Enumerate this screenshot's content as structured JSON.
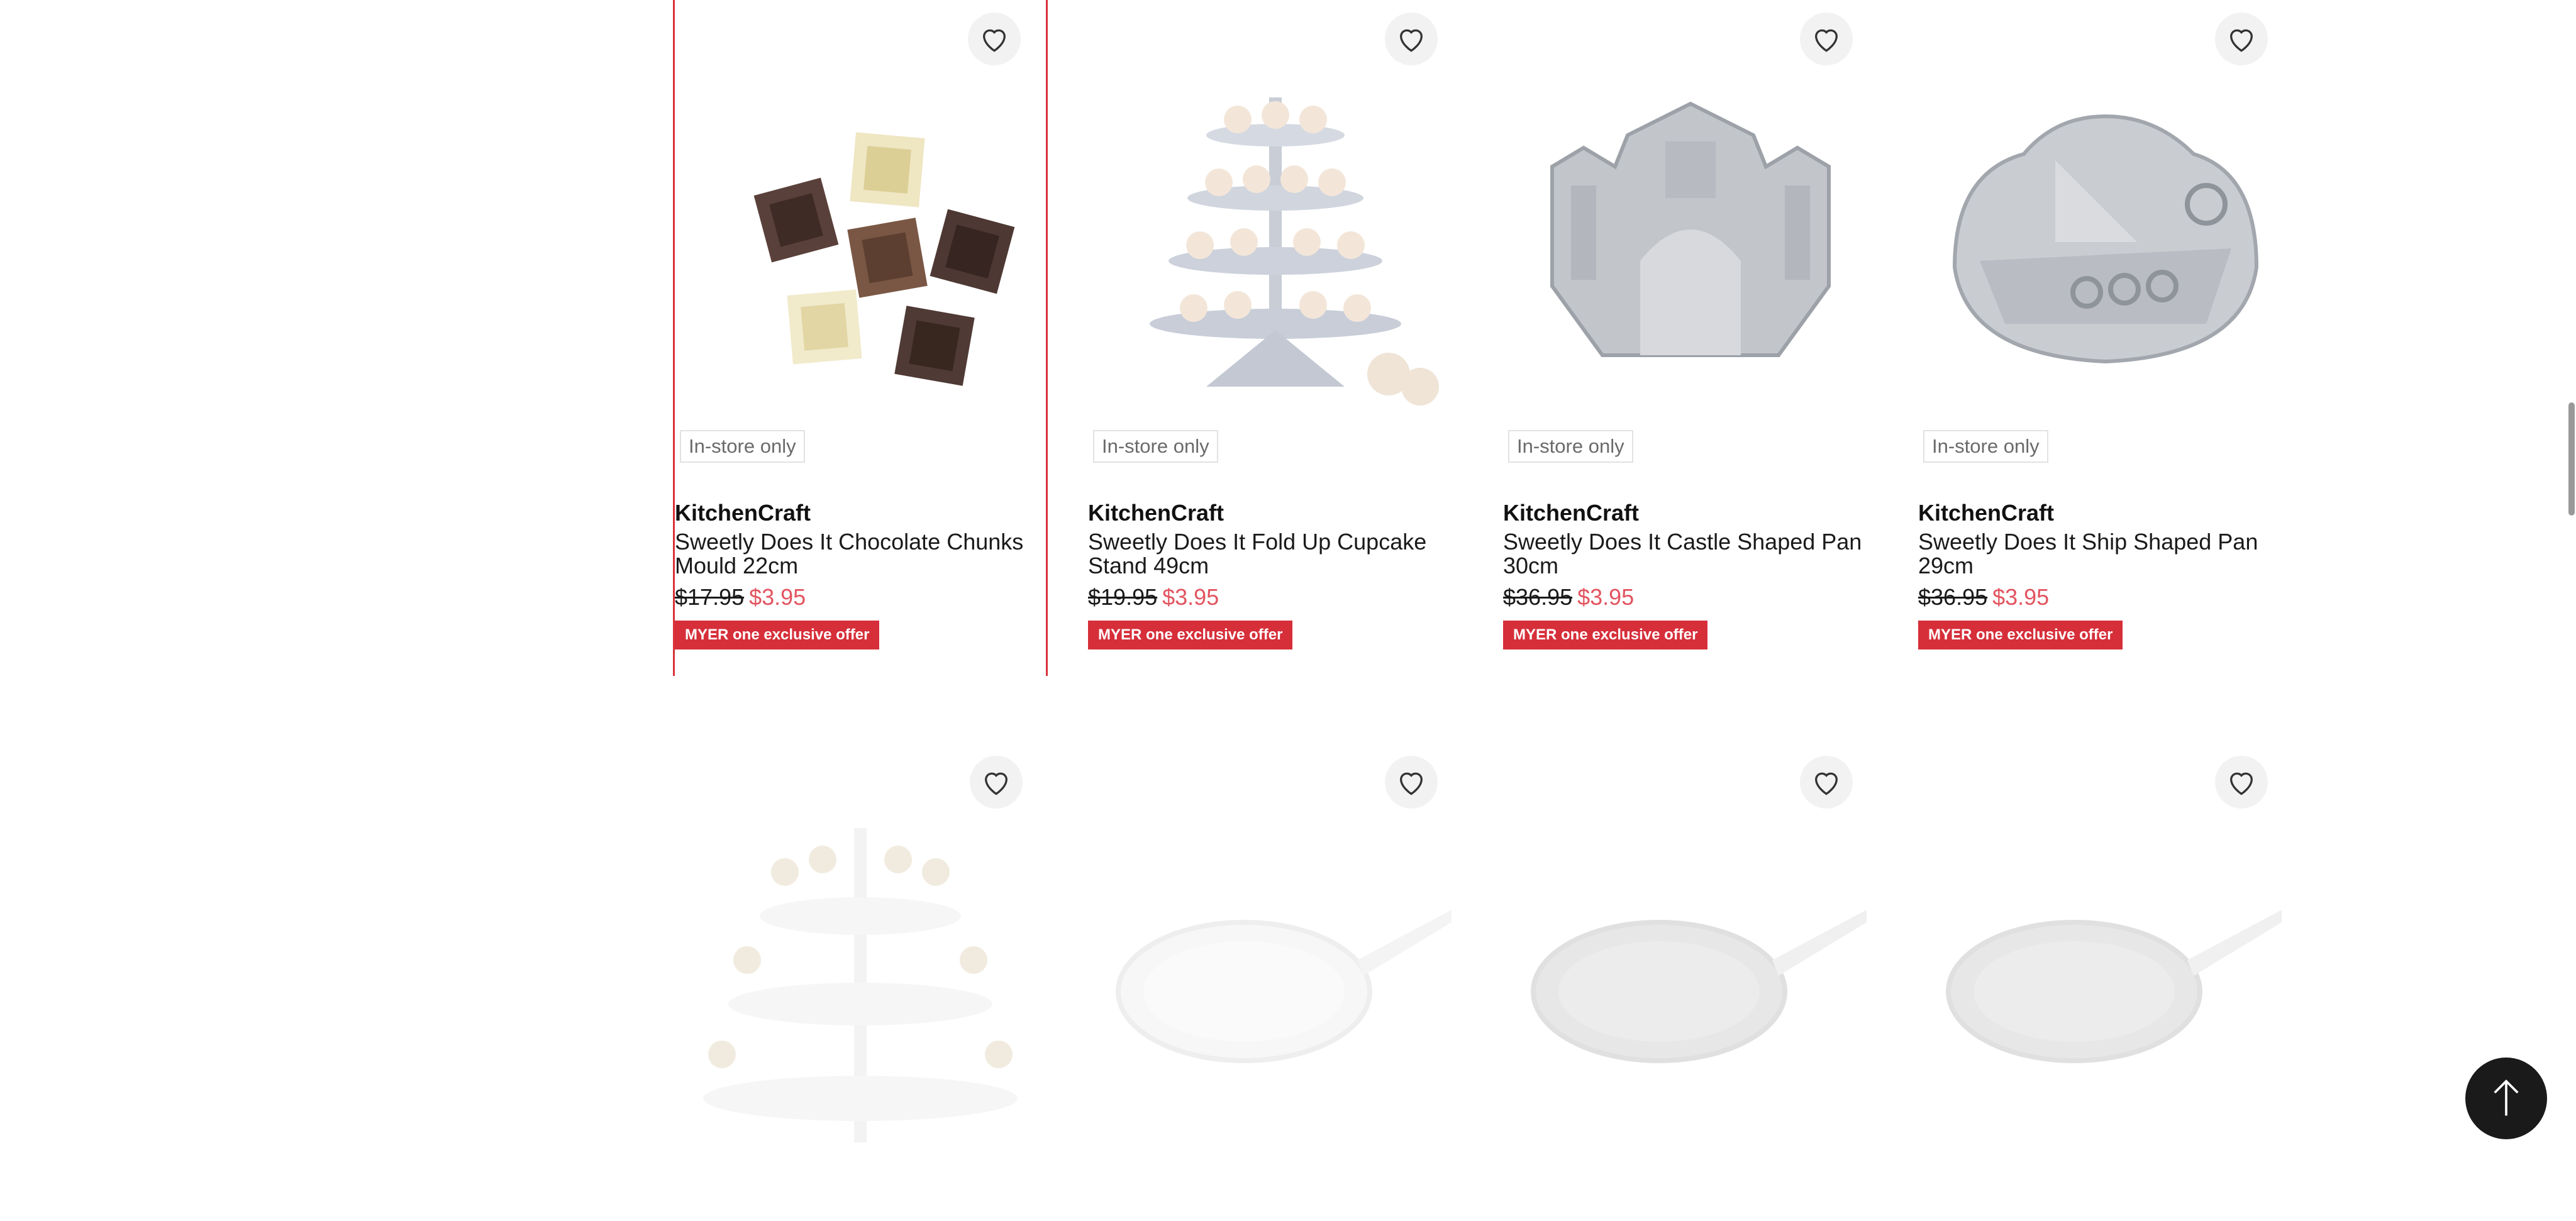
{
  "products": [
    {
      "brand": "KitchenCraft",
      "title": "Sweetly Does It Chocolate Chunks Mould 22cm",
      "old_price": "$17.95",
      "new_price": "$3.95",
      "badge": "In-store only",
      "offer": "MYER one exclusive offer",
      "icon": "chocolate-chunks-image"
    },
    {
      "brand": "KitchenCraft",
      "title": "Sweetly Does It Fold Up Cupcake Stand 49cm",
      "old_price": "$19.95",
      "new_price": "$3.95",
      "badge": "In-store only",
      "offer": "MYER one exclusive offer",
      "icon": "cupcake-stand-image"
    },
    {
      "brand": "KitchenCraft",
      "title": "Sweetly Does It Castle Shaped Pan 30cm",
      "old_price": "$36.95",
      "new_price": "$3.95",
      "badge": "In-store only",
      "offer": "MYER one exclusive offer",
      "icon": "castle-pan-image"
    },
    {
      "brand": "KitchenCraft",
      "title": "Sweetly Does It Ship Shaped Pan 29cm",
      "old_price": "$36.95",
      "new_price": "$3.95",
      "badge": "In-store only",
      "offer": "MYER one exclusive offer",
      "icon": "ship-pan-image"
    }
  ],
  "row2_icons": [
    "cake-pop-stand-image",
    "frying-pan-image",
    "frying-pan-image",
    "frying-pan-image"
  ],
  "icons": {
    "wishlist": "heart-icon",
    "back_to_top": "arrow-up-icon"
  },
  "colors": {
    "accent": "#d62f3a",
    "sale_price": "#e2545f",
    "selected_border": "#d8333b"
  }
}
